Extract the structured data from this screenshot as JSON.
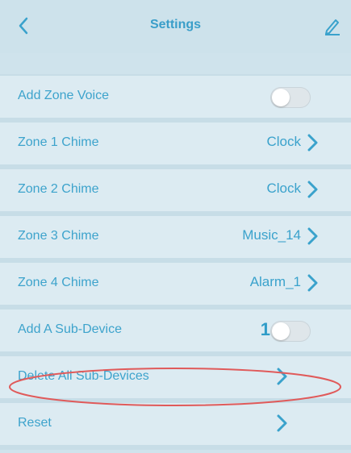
{
  "header": {
    "title": "Settings",
    "back_icon": "chevron-left-icon",
    "edit_icon": "pencil-icon"
  },
  "rows": [
    {
      "label": "Add Zone Voice",
      "control": "toggle",
      "toggle_on": false
    },
    {
      "label": "Zone 1 Chime",
      "value": "Clock"
    },
    {
      "label": "Zone 2 Chime",
      "value": "Clock"
    },
    {
      "label": "Zone 3 Chime",
      "value": "Music_14"
    },
    {
      "label": "Zone 4 Chime",
      "value": "Alarm_1"
    },
    {
      "label": "Add A Sub-Device",
      "count": "1",
      "control": "toggle",
      "toggle_on": false
    },
    {
      "label": "Delete All Sub-Devices",
      "highlighted": true
    },
    {
      "label": "Reset"
    }
  ],
  "colors": {
    "accent": "#3aa2cc",
    "background": "#cfe3ec",
    "highlight": "#e05a5a"
  }
}
